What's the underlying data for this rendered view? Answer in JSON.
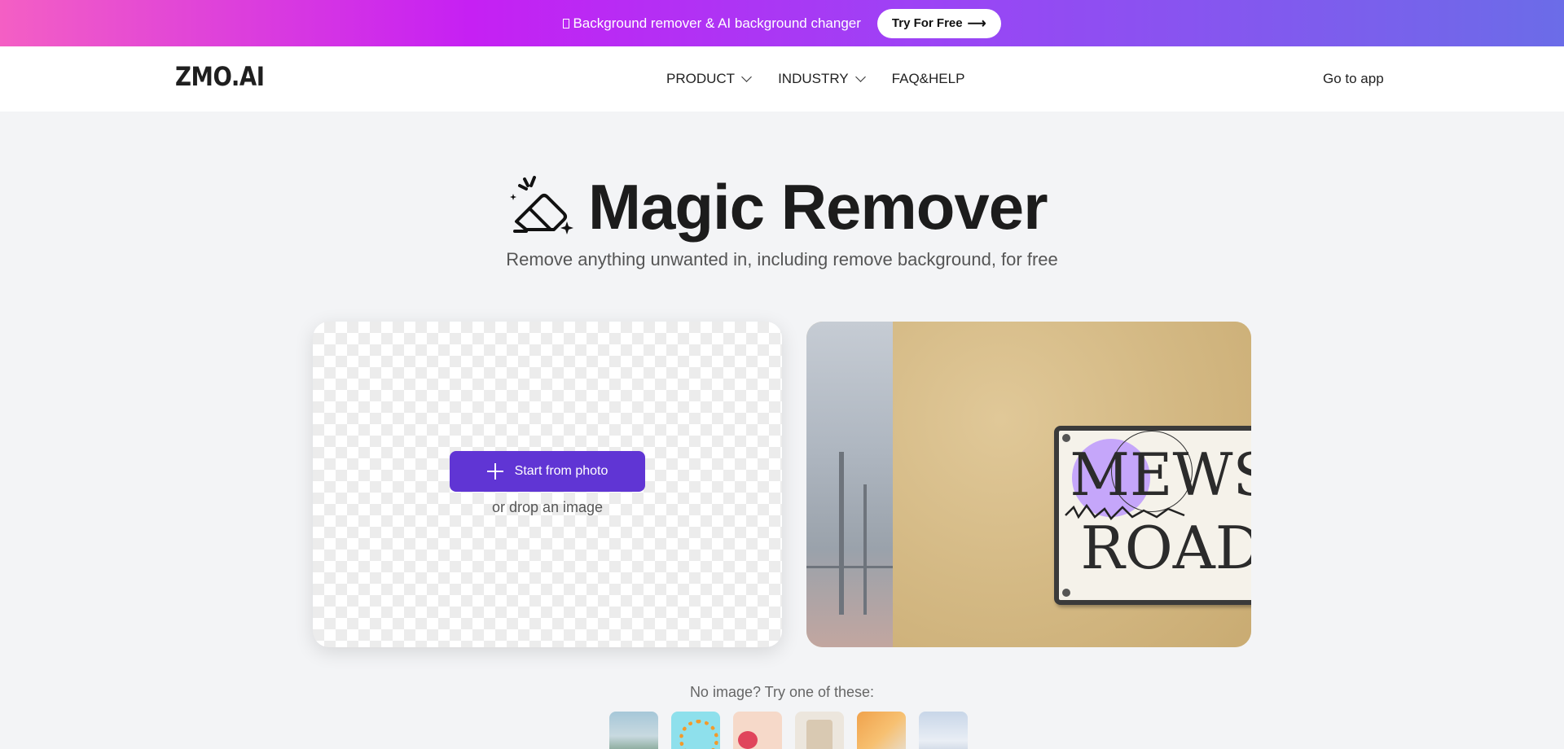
{
  "promo": {
    "text": "Background remover & AI background changer",
    "cta_label": "Try For Free",
    "cta_arrow": "⟶"
  },
  "nav": {
    "logo": "ZMO.AI",
    "items": [
      {
        "label": "PRODUCT",
        "has_dropdown": true
      },
      {
        "label": "INDUSTRY",
        "has_dropdown": true
      },
      {
        "label": "FAQ&HELP",
        "has_dropdown": false
      }
    ],
    "go_to_app": "Go to app"
  },
  "hero": {
    "title": "Magic Remover",
    "subtitle": "Remove anything unwanted in, including remove background, for free",
    "icon": "eraser-sparkle-icon"
  },
  "upload": {
    "button_label": "Start from photo",
    "drop_text": "or drop an image"
  },
  "demo": {
    "sign_line1": "MEWS",
    "sign_line2": "ROAD"
  },
  "samples": {
    "label": "No image? Try one of these:",
    "count": 6
  },
  "colors": {
    "primary": "#6035d4",
    "banner_start": "#f45fc4",
    "banner_end": "#6b6ce8",
    "background": "#f3f4f6"
  }
}
